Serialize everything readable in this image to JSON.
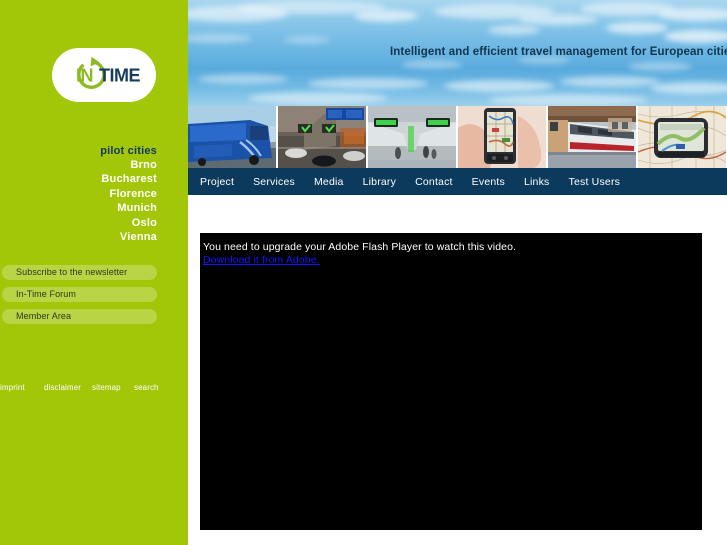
{
  "site": {
    "logo_in": "IN",
    "logo_time": "TIME",
    "tagline": "Intelligent and efficient travel management for European cities"
  },
  "sidebar": {
    "pilot_cities_title": "pilot cities",
    "cities": [
      {
        "label": "Brno"
      },
      {
        "label": "Bucharest"
      },
      {
        "label": "Florence"
      },
      {
        "label": "Munich"
      },
      {
        "label": "Oslo"
      },
      {
        "label": "Vienna"
      }
    ],
    "buttons": [
      {
        "label": "Subscribe to the newsletter"
      },
      {
        "label": "In-Time Forum"
      },
      {
        "label": "Member Area"
      }
    ],
    "footer_links": [
      {
        "label": "imprint"
      },
      {
        "label": "disclaimer"
      },
      {
        "label": "sitemap"
      },
      {
        "label": "search"
      }
    ]
  },
  "nav": {
    "items": [
      {
        "label": "Project"
      },
      {
        "label": "Services"
      },
      {
        "label": "Media"
      },
      {
        "label": "Library"
      },
      {
        "label": "Contact"
      },
      {
        "label": "Events"
      },
      {
        "label": "Links"
      },
      {
        "label": "Test Users"
      }
    ]
  },
  "photostrip": {
    "images": [
      {
        "name": "blue-bus-photo"
      },
      {
        "name": "tunnel-traffic-signage-photo"
      },
      {
        "name": "station-concourse-photo"
      },
      {
        "name": "handheld-gps-map-photo"
      },
      {
        "name": "train-at-platform-photo"
      },
      {
        "name": "satnav-on-roadmap-photo"
      }
    ]
  },
  "content": {
    "flash_message": "You need to upgrade your Adobe Flash Player to watch this video.",
    "flash_link": "Download it from Adobe."
  },
  "colors": {
    "sidebar_green": "#a2c608",
    "button_green": "#b9d444",
    "nav_navy": "#0b3a5d",
    "logo_navy": "#123a5a",
    "link_blue": "#1414ff"
  }
}
